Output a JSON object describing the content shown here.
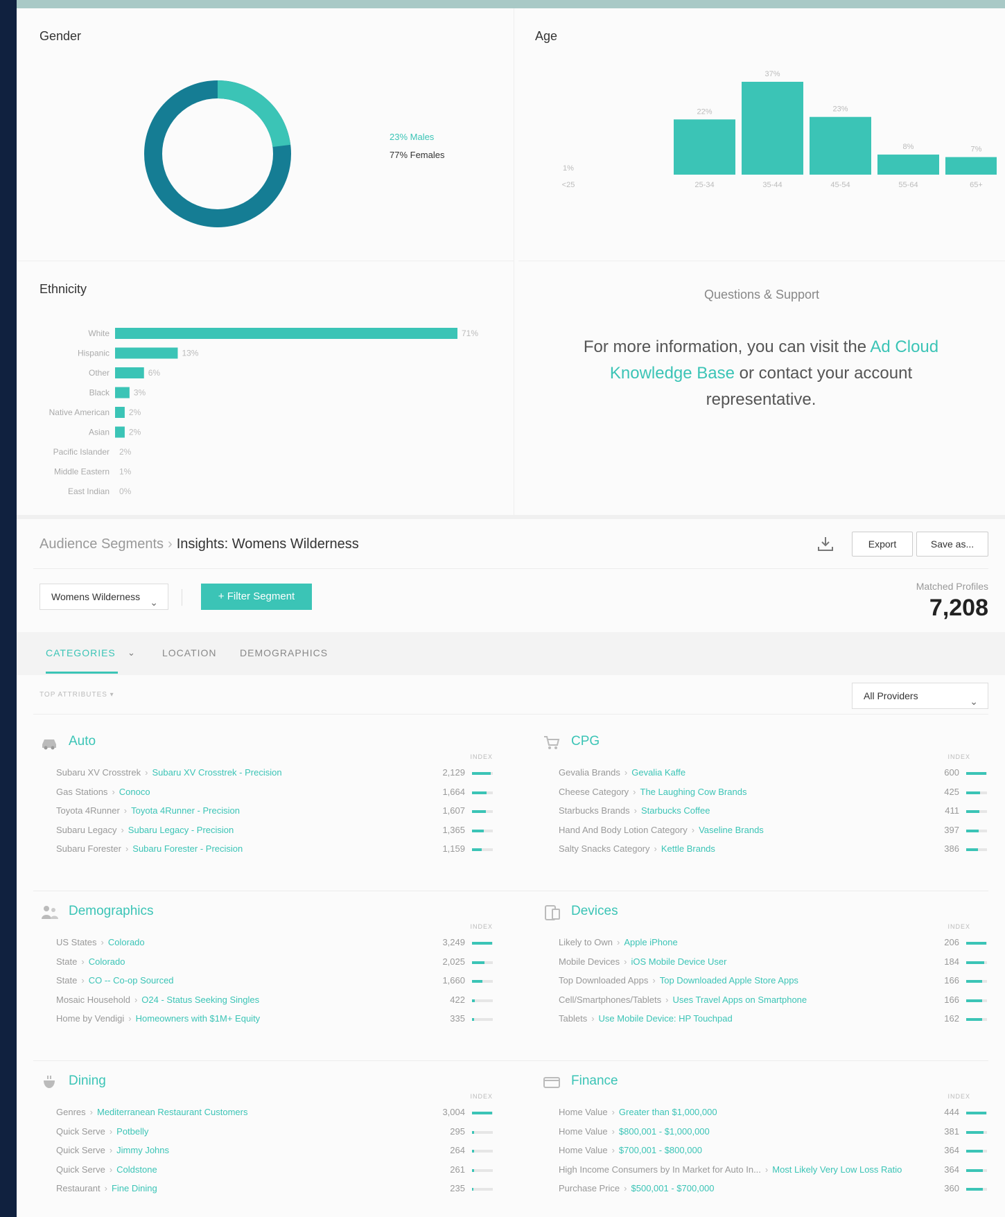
{
  "gender": {
    "title": "Gender",
    "males_label": "23% Males",
    "females_label": "77% Females",
    "males_pct": 23,
    "females_pct": 77,
    "male_color": "#3bc4b6",
    "female_color": "#157d94"
  },
  "age": {
    "title": "Age",
    "bars": [
      {
        "label": "<25",
        "value": 1,
        "value_label": "1%"
      },
      {
        "label": "25-34",
        "value": 22,
        "value_label": "22%"
      },
      {
        "label": "35-44",
        "value": 37,
        "value_label": "37%"
      },
      {
        "label": "45-54",
        "value": 23,
        "value_label": "23%"
      },
      {
        "label": "55-64",
        "value": 8,
        "value_label": "8%"
      },
      {
        "label": "65+",
        "value": 7,
        "value_label": "7%"
      }
    ]
  },
  "ethnicity": {
    "title": "Ethnicity",
    "bars": [
      {
        "label": "White",
        "value": 71,
        "value_label": "71%"
      },
      {
        "label": "Hispanic",
        "value": 13,
        "value_label": "13%"
      },
      {
        "label": "Other",
        "value": 6,
        "value_label": "6%"
      },
      {
        "label": "Black",
        "value": 3,
        "value_label": "3%"
      },
      {
        "label": "Native American",
        "value": 2,
        "value_label": "2%"
      },
      {
        "label": "Asian",
        "value": 2,
        "value_label": "2%"
      },
      {
        "label": "Pacific Islander",
        "value": 0,
        "value_label": "2%"
      },
      {
        "label": "Middle Eastern",
        "value": 0,
        "value_label": "1%"
      },
      {
        "label": "East Indian",
        "value": 0,
        "value_label": "0%"
      }
    ]
  },
  "support": {
    "title": "Questions & Support",
    "text_before": "For more information, you can visit the ",
    "link": "Ad Cloud Knowledge Base",
    "text_after": " or contact your account representative."
  },
  "segments": {
    "breadcrumb_root": "Audience Segments",
    "breadcrumb_current": "Insights: Womens Wilderness",
    "export_label": "Export",
    "save_label": "Save as...",
    "segment_select": "Womens Wilderness",
    "filter_label": "+ Filter Segment",
    "matched_label": "Matched Profiles",
    "matched_value": "7,208",
    "tabs": [
      "CATEGORIES",
      "LOCATION",
      "DEMOGRAPHICS"
    ],
    "sort_label": "TOP ATTRIBUTES ▾",
    "provider_select": "All Providers",
    "index_label": "INDEX"
  },
  "categories": [
    {
      "title": "Auto",
      "icon": "car-icon",
      "rows": [
        {
          "path": "Subaru XV Crosstrek",
          "leaf": "Subaru XV Crosstrek - Precision",
          "value": "2,129",
          "fill": 0.9
        },
        {
          "path": "Gas Stations",
          "leaf": "Conoco",
          "value": "1,664",
          "fill": 0.7
        },
        {
          "path": "Toyota 4Runner",
          "leaf": "Toyota 4Runner - Precision",
          "value": "1,607",
          "fill": 0.68
        },
        {
          "path": "Subaru Legacy",
          "leaf": "Subaru Legacy - Precision",
          "value": "1,365",
          "fill": 0.55
        },
        {
          "path": "Subaru Forester",
          "leaf": "Subaru Forester - Precision",
          "value": "1,159",
          "fill": 0.45
        }
      ]
    },
    {
      "title": "CPG",
      "icon": "cart-icon",
      "rows": [
        {
          "path": "Gevalia Brands",
          "leaf": "Gevalia Kaffe",
          "value": "600",
          "fill": 0.95
        },
        {
          "path": "Cheese Category",
          "leaf": "The Laughing Cow Brands",
          "value": "425",
          "fill": 0.65
        },
        {
          "path": "Starbucks Brands",
          "leaf": "Starbucks Coffee",
          "value": "411",
          "fill": 0.62
        },
        {
          "path": "Hand And Body Lotion Category",
          "leaf": "Vaseline Brands",
          "value": "397",
          "fill": 0.6
        },
        {
          "path": "Salty Snacks Category",
          "leaf": "Kettle Brands",
          "value": "386",
          "fill": 0.58
        }
      ]
    },
    {
      "title": "Demographics",
      "icon": "people-icon",
      "rows": [
        {
          "path": "US States",
          "leaf": "Colorado",
          "value": "3,249",
          "fill": 0.95
        },
        {
          "path": "State",
          "leaf": "Colorado",
          "value": "2,025",
          "fill": 0.6
        },
        {
          "path": "State",
          "leaf": "CO -- Co-op Sourced",
          "value": "1,660",
          "fill": 0.5
        },
        {
          "path": "Mosaic Household",
          "leaf": "O24 - Status Seeking Singles",
          "value": "422",
          "fill": 0.14
        },
        {
          "path": "Home by Vendigi",
          "leaf": "Homeowners with $1M+ Equity",
          "value": "335",
          "fill": 0.1
        }
      ]
    },
    {
      "title": "Devices",
      "icon": "device-icon",
      "rows": [
        {
          "path": "Likely to Own",
          "leaf": "Apple iPhone",
          "value": "206",
          "fill": 0.95
        },
        {
          "path": "Mobile Devices",
          "leaf": "iOS Mobile Device User",
          "value": "184",
          "fill": 0.85
        },
        {
          "path": "Top Downloaded Apps",
          "leaf": "Top Downloaded Apple Store Apps",
          "value": "166",
          "fill": 0.78
        },
        {
          "path": "Cell/Smartphones/Tablets",
          "leaf": "Uses Travel Apps on Smartphone",
          "value": "166",
          "fill": 0.78
        },
        {
          "path": "Tablets",
          "leaf": "Use Mobile Device: HP Touchpad",
          "value": "162",
          "fill": 0.76
        }
      ]
    },
    {
      "title": "Dining",
      "icon": "dining-icon",
      "rows": [
        {
          "path": "Genres",
          "leaf": "Mediterranean Restaurant Customers",
          "value": "3,004",
          "fill": 0.95
        },
        {
          "path": "Quick Serve",
          "leaf": "Potbelly",
          "value": "295",
          "fill": 0.1
        },
        {
          "path": "Quick Serve",
          "leaf": "Jimmy Johns",
          "value": "264",
          "fill": 0.09
        },
        {
          "path": "Quick Serve",
          "leaf": "Coldstone",
          "value": "261",
          "fill": 0.09
        },
        {
          "path": "Restaurant",
          "leaf": "Fine Dining",
          "value": "235",
          "fill": 0.08
        }
      ]
    },
    {
      "title": "Finance",
      "icon": "finance-icon",
      "rows": [
        {
          "path": "Home Value",
          "leaf": "Greater than $1,000,000",
          "value": "444",
          "fill": 0.95
        },
        {
          "path": "Home Value",
          "leaf": "$800,001 - $1,000,000",
          "value": "381",
          "fill": 0.82
        },
        {
          "path": "Home Value",
          "leaf": "$700,001 - $800,000",
          "value": "364",
          "fill": 0.8
        },
        {
          "path": "High Income Consumers by In Market for Auto In...",
          "leaf": "Most Likely Very Low Loss Ratio",
          "value": "364",
          "fill": 0.8
        },
        {
          "path": "Purchase Price",
          "leaf": "$500,001 - $700,000",
          "value": "360",
          "fill": 0.79
        }
      ]
    }
  ]
}
